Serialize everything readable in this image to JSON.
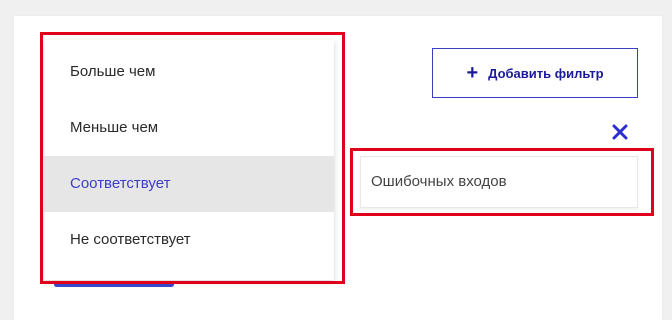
{
  "dropdown": {
    "items": [
      {
        "label": "Больше чем",
        "selected": false
      },
      {
        "label": "Меньше чем",
        "selected": false
      },
      {
        "label": "Соответствует",
        "selected": true
      },
      {
        "label": "Не соответствует",
        "selected": false
      }
    ]
  },
  "toolbar": {
    "add_filter_label": "Добавить фильтр",
    "add_filter_icon": "plus-icon",
    "remove_icon": "close-icon"
  },
  "filter": {
    "field_value": "Ошибочных входов"
  },
  "colors": {
    "accent": "#3a3fc4",
    "selected_text": "#3d3dc9",
    "selected_bg": "#e6e6e6",
    "highlight": "#e0001b"
  }
}
